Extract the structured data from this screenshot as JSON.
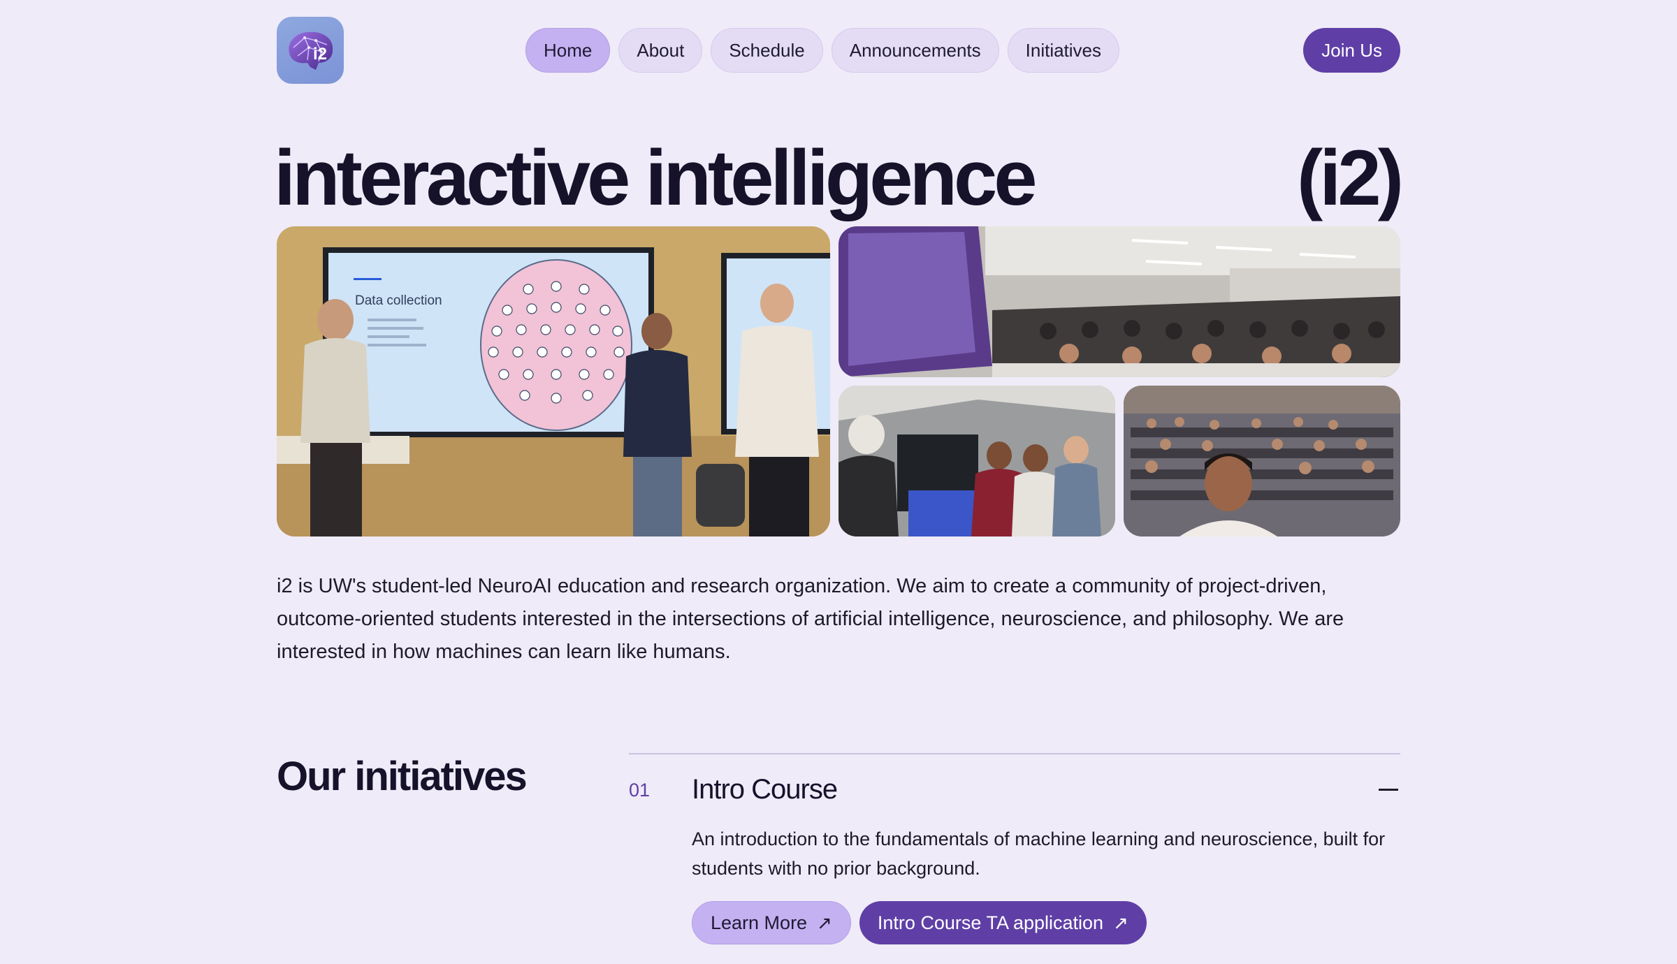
{
  "header": {
    "logo_text": "i2",
    "nav": [
      {
        "label": "Home",
        "active": true
      },
      {
        "label": "About",
        "active": false
      },
      {
        "label": "Schedule",
        "active": false
      },
      {
        "label": "Announcements",
        "active": false
      },
      {
        "label": "Initiatives",
        "active": false
      }
    ],
    "join_label": "Join Us"
  },
  "hero": {
    "title": "interactive intelligence",
    "tag": "(i2)",
    "slide_heading": "Data collection"
  },
  "description": "i2 is UW's student-led NeuroAI education and research organization. We aim to create a community of project-driven, outcome-oriented students interested in the intersections of artificial intelligence, neuroscience, and philosophy. We are interested in how machines can learn like humans.",
  "initiatives": {
    "title": "Our initiatives",
    "items": [
      {
        "number": "01",
        "title": "Intro Course",
        "description": "An introduction to the fundamentals of machine learning and neuroscience, built for students with no prior background.",
        "buttons": [
          {
            "label": "Learn More",
            "icon": "arrow-up-right-icon",
            "style": "light"
          },
          {
            "label": "Intro Course TA application",
            "icon": "arrow-up-right-icon",
            "style": "dark"
          }
        ]
      }
    ]
  },
  "colors": {
    "background": "#efebf8",
    "accent": "#5f3fa6",
    "accent_light": "#c4b1f1",
    "nav_pill": "#e4dcf5"
  }
}
